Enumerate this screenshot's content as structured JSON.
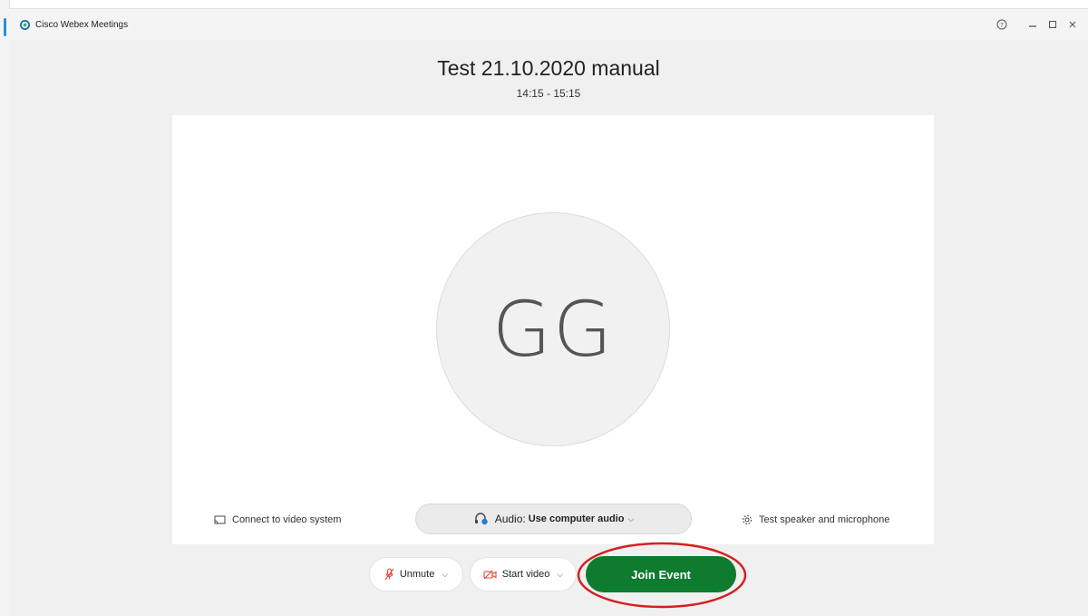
{
  "window": {
    "app_title": "Cisco Webex Meetings",
    "controls": {
      "help": "help-icon",
      "minimize": "minimize-icon",
      "maximize": "maximize-icon",
      "close": "close-icon"
    }
  },
  "meeting": {
    "title": "Test 21.10.2020 manual",
    "time": "14:15 - 15:15"
  },
  "preview": {
    "initials": "GG",
    "connect_label": "Connect to video system",
    "audio_label": "Audio:",
    "audio_value": "Use computer audio",
    "test_label": "Test speaker and microphone"
  },
  "controls": {
    "unmute_label": "Unmute",
    "start_video_label": "Start video",
    "join_label": "Join Event"
  },
  "colors": {
    "join_green": "#0f7b2f",
    "annotation_red": "#d42020",
    "muted_red": "#e0453b"
  }
}
